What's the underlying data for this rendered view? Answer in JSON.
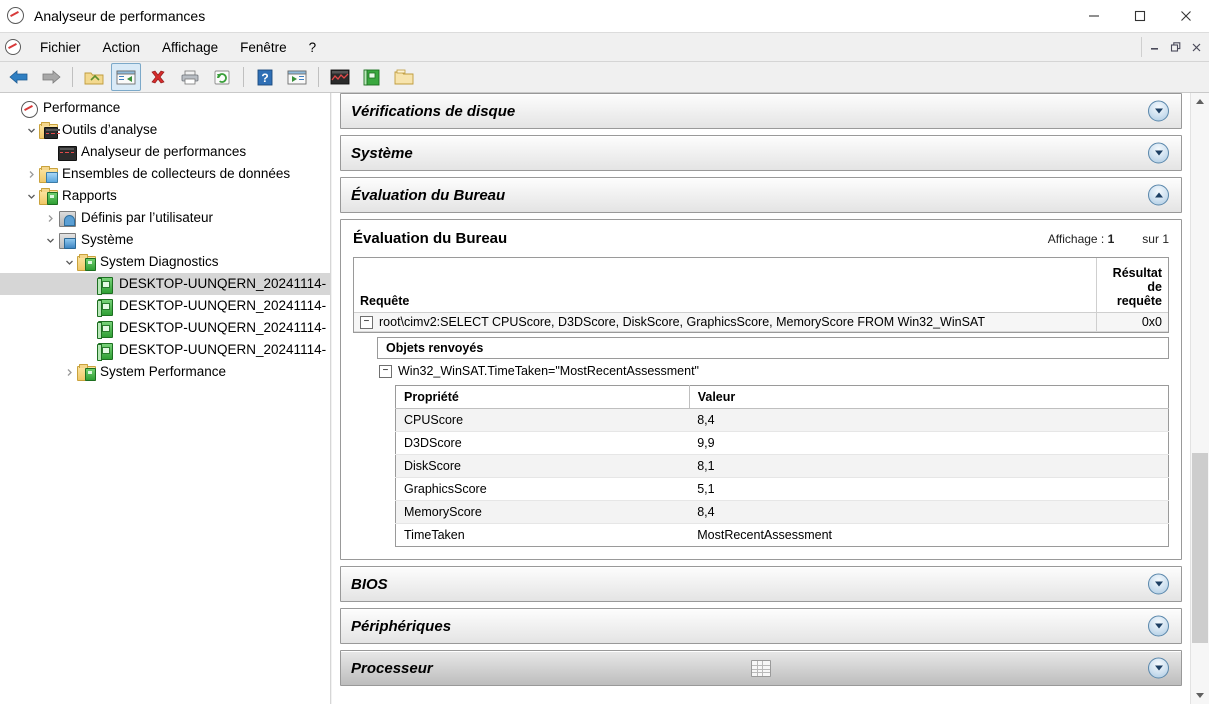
{
  "window": {
    "title": "Analyseur de performances",
    "icon": "performance-monitor-icon",
    "minimize_label": "—",
    "maximize_label": "□",
    "close_label": "✕"
  },
  "menu": {
    "items": [
      {
        "label": "Fichier"
      },
      {
        "label": "Action"
      },
      {
        "label": "Affichage"
      },
      {
        "label": "Fenêtre"
      },
      {
        "label": "?"
      }
    ],
    "mdi": {
      "minimize": "—",
      "restore": "❐",
      "close": "✕"
    }
  },
  "toolbar": {
    "buttons": [
      {
        "name": "back-icon",
        "label": "Précédent"
      },
      {
        "name": "forward-icon",
        "label": "Suivant"
      },
      {
        "name": "up-folder-icon",
        "label": "Dossier parent"
      },
      {
        "name": "show-hide-tree-icon",
        "label": "Afficher/Masquer l'arborescence"
      },
      {
        "name": "delete-icon",
        "label": "Supprimer"
      },
      {
        "name": "print-icon",
        "label": "Imprimer"
      },
      {
        "name": "refresh-icon",
        "label": "Actualiser"
      },
      {
        "name": "help-icon",
        "label": "Aide"
      },
      {
        "name": "properties-icon",
        "label": "Propriétés"
      },
      {
        "name": "perfmon-view-icon",
        "label": "Analyseur de performances"
      },
      {
        "name": "report-icon",
        "label": "Rapport"
      },
      {
        "name": "new-folder-icon",
        "label": "Nouveau dossier"
      }
    ]
  },
  "tree": {
    "nodes": [
      {
        "label": "Performance",
        "depth": 0,
        "twist": "",
        "icon": "perfmon-circle-icon",
        "selected": false
      },
      {
        "label": "Outils d’analyse",
        "depth": 1,
        "twist": "v",
        "icon": "folder-monitor-icon",
        "selected": false
      },
      {
        "label": "Analyseur de performances",
        "depth": 2,
        "twist": "",
        "icon": "perfmon-graph-icon",
        "selected": false
      },
      {
        "label": "Ensembles de collecteurs de données",
        "depth": 1,
        "twist": ">",
        "icon": "folder-blue-icon",
        "selected": false
      },
      {
        "label": "Rapports",
        "depth": 1,
        "twist": "v",
        "icon": "folder-green-icon",
        "selected": false
      },
      {
        "label": "Définis par l’utilisateur",
        "depth": 2,
        "twist": ">",
        "icon": "user-report-icon",
        "selected": false
      },
      {
        "label": "Système",
        "depth": 2,
        "twist": "v",
        "icon": "system-report-icon",
        "selected": false
      },
      {
        "label": "System Diagnostics",
        "depth": 3,
        "twist": "v",
        "icon": "folder-green-icon",
        "selected": false
      },
      {
        "label": "DESKTOP-UUNQERN_20241114-",
        "depth": 4,
        "twist": "",
        "icon": "report-book-icon",
        "selected": true
      },
      {
        "label": "DESKTOP-UUNQERN_20241114-",
        "depth": 4,
        "twist": "",
        "icon": "report-book-icon",
        "selected": false
      },
      {
        "label": "DESKTOP-UUNQERN_20241114-",
        "depth": 4,
        "twist": "",
        "icon": "report-book-icon",
        "selected": false
      },
      {
        "label": "DESKTOP-UUNQERN_20241114-",
        "depth": 4,
        "twist": "",
        "icon": "report-book-icon",
        "selected": false
      },
      {
        "label": "System Performance",
        "depth": 3,
        "twist": ">",
        "icon": "folder-green-icon",
        "selected": false
      }
    ]
  },
  "report": {
    "sections_top": [
      {
        "title": "Vérifications de disque",
        "state": "collapsed",
        "chevron": "down"
      },
      {
        "title": "Système",
        "state": "collapsed",
        "chevron": "down"
      },
      {
        "title": "Évaluation du Bureau",
        "state": "expanded",
        "chevron": "up"
      }
    ],
    "sections_bottom": [
      {
        "title": "BIOS",
        "state": "collapsed",
        "chevron": "down",
        "dark": false,
        "grid_icon": false
      },
      {
        "title": "Périphériques",
        "state": "collapsed",
        "chevron": "down",
        "dark": false,
        "grid_icon": false
      },
      {
        "title": "Processeur",
        "state": "collapsed",
        "chevron": "down",
        "dark": true,
        "grid_icon": true
      }
    ],
    "panel": {
      "title": "Évaluation du Bureau",
      "display_label": "Affichage :",
      "display_value": "1",
      "of_label": "sur",
      "of_value": "1",
      "query_table": {
        "col_query": "Requête",
        "col_result": "Résultat de requête",
        "query_text": "root\\cimv2:SELECT CPUScore, D3DScore, DiskScore, GraphicsScore, MemoryScore FROM Win32_WinSAT",
        "result_value": "0x0",
        "expander": "−"
      },
      "returned_objects": {
        "heading": "Objets renvoyés",
        "instance": "Win32_WinSAT.TimeTaken=\"MostRecentAssessment\"",
        "expander": "−",
        "col_property": "Propriété",
        "col_value": "Valeur",
        "rows": [
          {
            "property": "CPUScore",
            "value": "8,4"
          },
          {
            "property": "D3DScore",
            "value": "9,9"
          },
          {
            "property": "DiskScore",
            "value": "8,1"
          },
          {
            "property": "GraphicsScore",
            "value": "5,1"
          },
          {
            "property": "MemoryScore",
            "value": "8,4"
          },
          {
            "property": "TimeTaken",
            "value": "MostRecentAssessment"
          }
        ]
      }
    }
  },
  "scrollbar": {
    "up_arrow": "▲",
    "down_arrow": "▼"
  },
  "colors": {
    "accent_blue": "#3f86c4",
    "selection_gray": "#d6d6d6",
    "chrome_gray": "#f0f0f0",
    "section_border": "#999999",
    "green_report": "#2f9f34"
  }
}
